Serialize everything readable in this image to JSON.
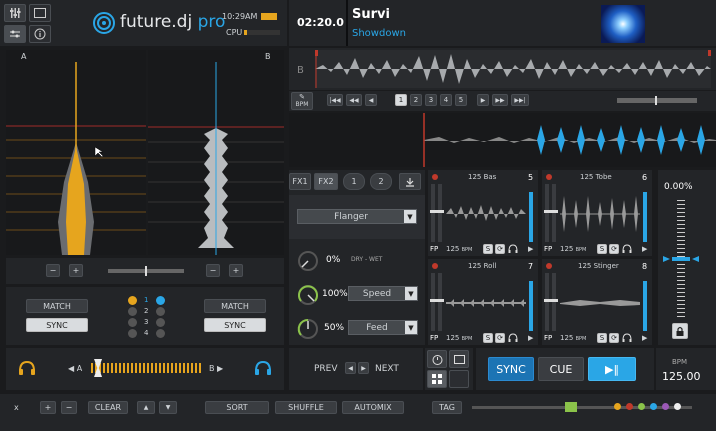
{
  "app": {
    "brand": "future.dj",
    "brand_suffix": "pro",
    "clock": "10:29AM",
    "cpu_label": "CPU"
  },
  "colors": {
    "accent": "#2aa6e6",
    "orange": "#e6a51e",
    "red": "#c0392b"
  },
  "track": {
    "time": "02:20.0",
    "title": "Survi",
    "artist": "Showdown"
  },
  "waveform": {
    "deck_label": "B"
  },
  "transport": {
    "bpm_label": "BPM",
    "nav_first": "|◀◀",
    "nav_back": "◀◀",
    "nav_prev": "◀",
    "pages": [
      "1",
      "2",
      "3",
      "4",
      "5"
    ],
    "nav_next": "▶",
    "nav_fwd": "▶▶",
    "nav_last": "▶▶|"
  },
  "decks": {
    "a_label": "A",
    "b_label": "B"
  },
  "fx": {
    "tab1": "FX1",
    "tab2": "FX2",
    "btn1": "1",
    "btn2": "2",
    "effect": "Flanger",
    "drywet_value": "0%",
    "drywet_label": "DRY - WET",
    "speed_value": "100%",
    "speed_label": "Speed",
    "feed_value": "50%",
    "feed_label": "Feed"
  },
  "samples": [
    {
      "name": "125 Bas",
      "num": "5",
      "bpm": "125",
      "bpm_unit": "BPM",
      "fp": "FP",
      "s": "S"
    },
    {
      "name": "125 Tobe",
      "num": "6",
      "bpm": "125",
      "bpm_unit": "BPM",
      "fp": "FP",
      "s": "S"
    },
    {
      "name": "125 Roll",
      "num": "7",
      "bpm": "125",
      "bpm_unit": "BPM",
      "fp": "FP",
      "s": "S"
    },
    {
      "name": "125 Stinger",
      "num": "8",
      "bpm": "125",
      "bpm_unit": "BPM",
      "fp": "FP",
      "s": "S"
    }
  ],
  "pitch": {
    "value": "0.00%",
    "bpm_label": "BPM",
    "bpm_value": "125.00",
    "position": 0.5
  },
  "mixer": {
    "minus": "−",
    "plus": "+",
    "match": "MATCH",
    "sync": "SYNC",
    "leds": [
      "1",
      "2",
      "3",
      "4"
    ],
    "cross_a": "A",
    "cross_b": "B",
    "crossfader": 0.03
  },
  "controls": {
    "prev": "PREV",
    "next": "NEXT",
    "sync": "SYNC",
    "cue": "CUE",
    "play": "▶‖"
  },
  "footer": {
    "close": "x",
    "plus": "+",
    "minus": "−",
    "clear": "CLEAR",
    "up": "▲",
    "down": "▼",
    "sort": "SORT",
    "shuffle": "SHUFFLE",
    "automix": "AUTOMIX",
    "tag": "TAG"
  }
}
